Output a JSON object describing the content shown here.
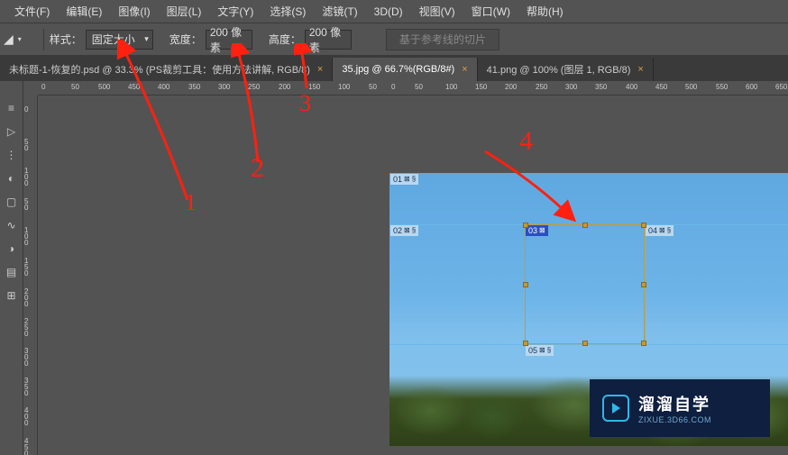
{
  "menubar": {
    "items": [
      {
        "label": "文件(F)"
      },
      {
        "label": "编辑(E)"
      },
      {
        "label": "图像(I)"
      },
      {
        "label": "图层(L)"
      },
      {
        "label": "文字(Y)"
      },
      {
        "label": "选择(S)"
      },
      {
        "label": "滤镜(T)"
      },
      {
        "label": "3D(D)"
      },
      {
        "label": "视图(V)"
      },
      {
        "label": "窗口(W)"
      },
      {
        "label": "帮助(H)"
      }
    ]
  },
  "options": {
    "style_label": "样式：",
    "style_value": "固定大小",
    "width_label": "宽度：",
    "width_value": "200 像素",
    "height_label": "高度：",
    "height_value": "200 像素",
    "guide_button": "基于参考线的切片"
  },
  "tabs": [
    {
      "title": "未标题-1-恢复的.psd @ 33.3% (PS裁剪工具：使用方法讲解, RGB/8)",
      "active": false,
      "dirty": true
    },
    {
      "title": "35.jpg @ 66.7%(RGB/8#)",
      "active": true,
      "dirty": true
    },
    {
      "title": "41.png @ 100% (图层 1, RGB/8)",
      "active": false,
      "dirty": true
    }
  ],
  "ruler": {
    "h": [
      "0",
      "50",
      "500",
      "450",
      "400",
      "350",
      "300",
      "250",
      "200",
      "150",
      "100",
      "50",
      "0",
      "50",
      "100",
      "150",
      "200",
      "250",
      "300",
      "350",
      "400",
      "450",
      "500",
      "550",
      "600",
      "650"
    ],
    "v": [
      "0",
      "50",
      "100",
      "150",
      "200",
      "250",
      "300",
      "350",
      "400",
      "450"
    ]
  },
  "slices": {
    "badges": [
      {
        "num": "01",
        "active": false
      },
      {
        "num": "02",
        "active": false
      },
      {
        "num": "03",
        "active": true
      },
      {
        "num": "04",
        "active": false
      },
      {
        "num": "05",
        "active": false
      }
    ]
  },
  "annotations": {
    "n1": "1",
    "n2": "2",
    "n3": "3",
    "n4": "4"
  },
  "watermark": {
    "title": "溜溜自学",
    "sub": "ZIXUE.3D66.COM"
  }
}
